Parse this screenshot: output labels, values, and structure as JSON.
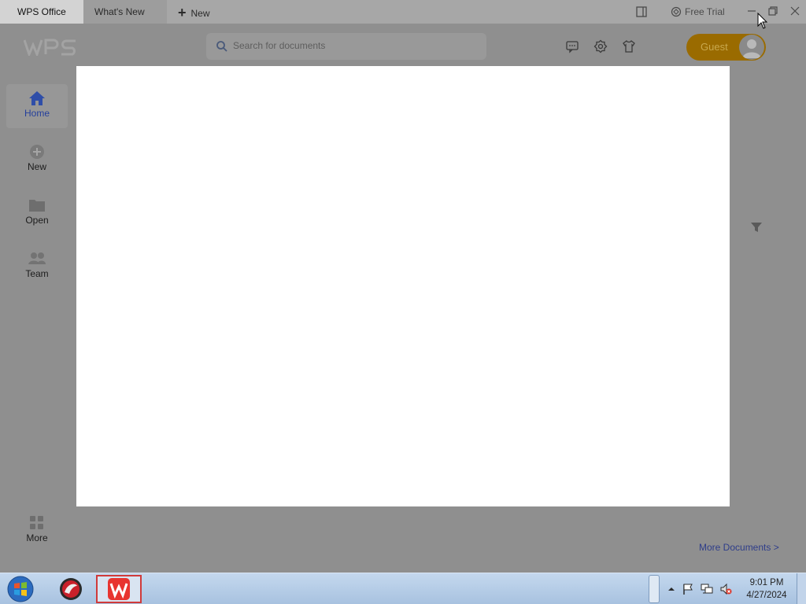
{
  "tabs": {
    "active": "WPS Office",
    "whats_new": "What's New",
    "new": "New"
  },
  "titlebar": {
    "free_trial": "Free Trial"
  },
  "header": {
    "search_placeholder": "Search for documents",
    "guest_label": "Guest"
  },
  "sidebar": {
    "items": [
      {
        "label": "Home",
        "icon": "home-icon",
        "active": true
      },
      {
        "label": "New",
        "icon": "plus-circle-icon"
      },
      {
        "label": "Open",
        "icon": "folder-icon"
      },
      {
        "label": "Team",
        "icon": "team-icon"
      }
    ],
    "more": "More"
  },
  "main": {
    "more_documents": "More Documents >"
  },
  "taskbar": {
    "time": "9:01 PM",
    "date": "4/27/2024"
  },
  "colors": {
    "accent": "#243f9c",
    "guest_button": "#9a6b00",
    "overlay_bg": "#8f8f8f",
    "modal_bg": "#ffffff"
  }
}
